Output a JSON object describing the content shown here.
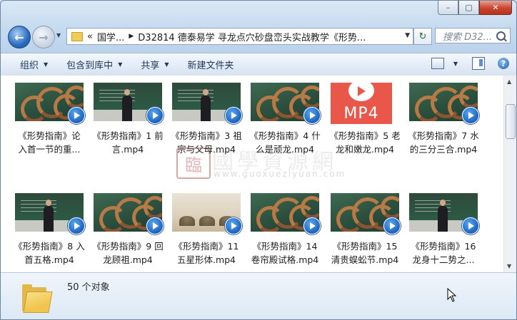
{
  "window": {
    "caption": {
      "minimize": "–",
      "maximize": "▢",
      "close": "✕"
    }
  },
  "nav": {
    "back_glyph": "←",
    "forward_glyph": "→",
    "history_glyph": "▼",
    "address": {
      "overflow": "«",
      "crumb1": "国学...",
      "sep": "▶",
      "crumb2": "D32814 德泰易学 寻龙点穴砂盘峦头实战教学《形势...",
      "dropdown": "▼"
    },
    "refresh_glyph": "↻",
    "search_placeholder": "搜索 D32..."
  },
  "toolbar": {
    "organize": "组织",
    "include_in_library": "包含到库中",
    "share": "共享",
    "new_folder": "新建文件夹",
    "arrow": "▼",
    "help": "?"
  },
  "files": [
    {
      "caption": "《形势指南》论\n入首一节的重...",
      "thumb": "anim"
    },
    {
      "caption": "《形势指南》1 前\n言.mp4",
      "thumb": "lect"
    },
    {
      "caption": "《形势指南》3 祖\n宗与父母.mp4",
      "thumb": "lect"
    },
    {
      "caption": "《形势指南》4 什\n么是顽龙.mp4",
      "thumb": "anim"
    },
    {
      "caption": "《形势指南》5 老\n龙和嫩龙.mp4",
      "thumb": "mp4",
      "mp4_label": "MP4"
    },
    {
      "caption": "《形势指南》7 水\n的三分三合.mp4",
      "thumb": "anim"
    },
    {
      "caption": "《形势指南》8 入\n首五格.mp4",
      "thumb": "lect"
    },
    {
      "caption": "《形势指南》9 回\n龙顾祖.mp4",
      "thumb": "anim"
    },
    {
      "caption": "《形势指南》11\n五星形体.mp4",
      "thumb": "sand"
    },
    {
      "caption": "《形势指南》14\n卷帘殿试格.mp4",
      "thumb": "anim"
    },
    {
      "caption": "《形势指南》15\n清贵蜈蚣节.mp4",
      "thumb": "anim"
    },
    {
      "caption": "《形势指南》16\n龙身十二势之...",
      "thumb": "lect"
    }
  ],
  "watermark": {
    "seal": "臨",
    "title": "國學資源網",
    "url": "www.guoxueziyuan.com"
  },
  "scrollbar": {
    "up": "▲",
    "down": "▼"
  },
  "details": {
    "object_count": "50 个对象"
  }
}
